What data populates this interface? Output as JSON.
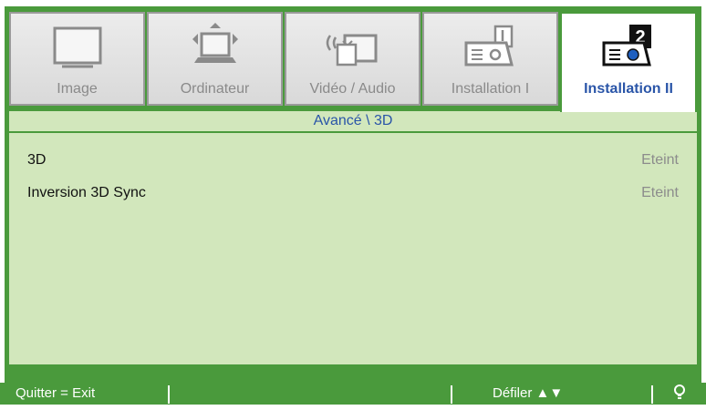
{
  "tabs": [
    {
      "label": "Image",
      "icon": "monitor-icon",
      "active": false
    },
    {
      "label": "Ordinateur",
      "icon": "computer-icon",
      "active": false
    },
    {
      "label": "Vidéo / Audio",
      "icon": "video-audio-icon",
      "active": false
    },
    {
      "label": "Installation I",
      "icon": "projector-settings-1-icon",
      "active": false
    },
    {
      "label": "Installation II",
      "icon": "projector-settings-2-icon",
      "active": true
    }
  ],
  "section_title": "Avancé \\ 3D",
  "settings": [
    {
      "label": "3D",
      "value": "Eteint"
    },
    {
      "label": "Inversion 3D Sync",
      "value": "Eteint"
    }
  ],
  "footer": {
    "exit_hint": "Quitter = Exit",
    "scroll_hint": "Défiler ▲▼",
    "bulb_icon": "bulb-icon"
  },
  "colors": {
    "frame_green": "#4a9a3c",
    "panel_green": "#d2e7bc",
    "active_blue": "#2a55a8",
    "inactive_gray": "#8a8a8a"
  }
}
